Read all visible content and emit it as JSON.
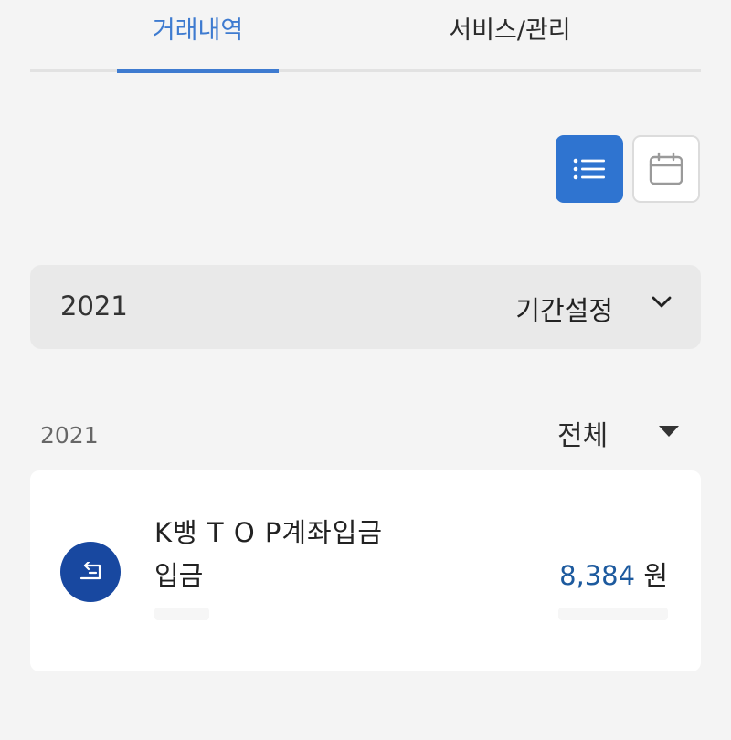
{
  "tabs": [
    {
      "label": "거래내역",
      "active": true
    },
    {
      "label": "서비스/관리",
      "active": false
    }
  ],
  "view_toggle": {
    "list_icon": "list-icon",
    "calendar_icon": "calendar-icon",
    "active": "list"
  },
  "period": {
    "year": "2021",
    "label": "기간설정",
    "icon": "chevron-down-icon"
  },
  "list": {
    "year": "2021",
    "filter_label": "전체",
    "filter_icon": "caret-down-icon"
  },
  "transactions": [
    {
      "title": "K뱅 T O P계좌입금",
      "type": "입금",
      "amount": "8,384",
      "currency": "원",
      "icon": "transfer-in-icon"
    }
  ],
  "colors": {
    "accent": "#3e7bd0",
    "active_button": "#2f74d0",
    "icon_circle": "#1848a0",
    "amount": "#1d5a9e"
  }
}
